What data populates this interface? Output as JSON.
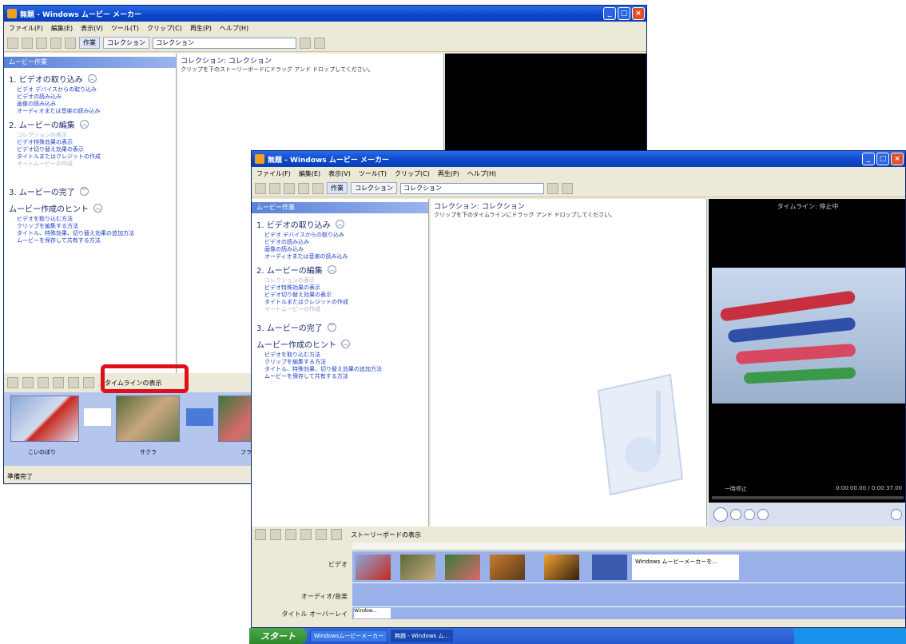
{
  "window_title": "無題 - Windows ムービー メーカー",
  "menu": [
    "ファイル(F)",
    "編集(E)",
    "表示(V)",
    "ツール(T)",
    "クリップ(C)",
    "再生(P)",
    "ヘルプ(H)"
  ],
  "toolbar": {
    "tasks_label": "作業",
    "collections_label": "コレクション",
    "combo_value": "コレクション"
  },
  "tasks_panel": {
    "header": "ムービー作業",
    "sections": [
      {
        "title": "1. ビデオの取り込み",
        "links": [
          "ビデオ デバイスからの取り込み",
          "ビデオの読み込み",
          "画像の読み込み",
          "オーディオまたは音楽の読み込み"
        ]
      },
      {
        "title": "2. ムービーの編集",
        "links": [
          "コレクションの表示",
          "ビデオ特殊効果の表示",
          "ビデオ切り替え効果の表示",
          "タイトルまたはクレジットの作成",
          "オートムービーの作成"
        ]
      },
      {
        "title": "3. ムービーの完了",
        "links": []
      },
      {
        "title": "ムービー作成のヒント",
        "links": [
          "ビデオを取り込む方法",
          "クリップを編集する方法",
          "タイトル、特殊効果、切り替え効果の追加方法",
          "ムービーを保存して共有する方法"
        ]
      }
    ]
  },
  "collection": {
    "title": "コレクション: コレクション",
    "hint_storyboard": "クリップを下のストーリーボードにドラッグ アンド ドロップしてください。",
    "hint_timeline": "クリップを下のタイムラインにドラッグ アンド ドロップしてください。"
  },
  "back_window": {
    "storyboard_button": "タイムラインの表示",
    "clips": [
      "こいのぼり",
      "サクラ",
      "フラワング"
    ],
    "status": "準備完了"
  },
  "front_window": {
    "preview_title": "タイムライン: 停止中",
    "preview_status": "一時停止",
    "preview_time": "0:00:00.00 / 0:00:37.00",
    "timeline_button": "ストーリーボードの表示",
    "track_labels": [
      "ビデオ",
      "オーディオ/音楽",
      "タイトル オーバーレイ"
    ],
    "title_clip": "Windows ムービーメーカーを...",
    "overlay_clip": "Window..."
  },
  "taskbar": {
    "start": "スタート",
    "items": [
      "Windowsムービーメーカー",
      "無題 - Windows ム..."
    ]
  }
}
